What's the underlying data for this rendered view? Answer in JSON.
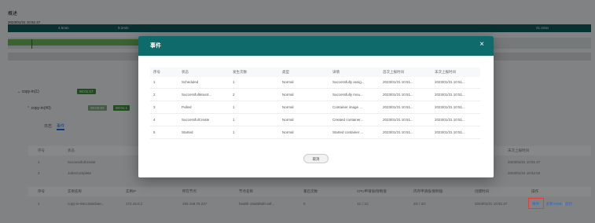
{
  "page": {
    "header_title": "概述"
  },
  "timeline": {
    "date": "2023/01/31 10:51:47",
    "ticks": [
      "4.6min",
      "9.2min",
      "41.4min"
    ]
  },
  "tree": {
    "job_label": "copy-in(1)",
    "job_time": "00:01:17",
    "pod_label": "copy-in(#0)",
    "pod_time_a": "00:00:04",
    "pod_time_b": "00:01:1"
  },
  "tabs": {
    "log": "日志",
    "events": "事件"
  },
  "status_table": {
    "headers": {
      "index": "序号",
      "status": "状态",
      "last_report": "末次上报时间"
    },
    "rows": [
      {
        "index": "1",
        "status": "SuccessfulCreate",
        "last_report": "2023/01/31 10:51:47"
      },
      {
        "index": "2",
        "status": "JobIsComplete",
        "last_report": "2023/01/31 10:52:02"
      }
    ]
  },
  "pods_table": {
    "headers": [
      "序号",
      "实例名称",
      "实例IP",
      "所在节点",
      "节点名称",
      "重启次数",
      "CPU申请值/限制值",
      "内存申请值/限制值",
      "创建时间",
      "操作"
    ],
    "row": [
      "1",
      "copy-in-59cc2a5cbae...",
      "172.16.0.2",
      "192.168.75.237",
      "health-16a8d5d0-a3f...",
      "0",
      "1C / 1C",
      "2G / 2G",
      "2023/01/31 10:51:47"
    ],
    "ops": {
      "events": "事件",
      "view_yaml": "查看YAML",
      "monitor": "监控",
      "sep": "|"
    }
  },
  "modal": {
    "title": "事件",
    "close_glyph": "×",
    "headers": [
      "序号",
      "状态",
      "发生次数",
      "类型",
      "详情",
      "首次上报时间",
      "末次上报时间"
    ],
    "rows": [
      [
        "1",
        "Scheduled",
        "1",
        "Normal",
        "Successfully assig...",
        "2023/01/31 10:51...",
        "2023/01/31 10:51..."
      ],
      [
        "2",
        "SuccessfulMount...",
        "2",
        "Normal",
        "Successfully mou...",
        "2023/01/31 10:51...",
        "2023/01/31 10:51..."
      ],
      [
        "3",
        "Pulled",
        "1",
        "Normal",
        "Container image ...",
        "2023/01/31 10:51...",
        "2023/01/31 10:51..."
      ],
      [
        "4",
        "SuccessfulCreate",
        "1",
        "Normal",
        "Created container...",
        "2023/01/31 10:51...",
        "2023/01/31 10:51..."
      ],
      [
        "5",
        "Started",
        "1",
        "Normal",
        "Started container ...",
        "2023/01/31 10:51...",
        "2023/01/31 10:51..."
      ]
    ],
    "cancel_label": "取消"
  },
  "colors": {
    "primary": "#0f6a6c",
    "link": "#1e6dd8",
    "highlight": "#e53b3b",
    "success": "#6bb45a"
  }
}
